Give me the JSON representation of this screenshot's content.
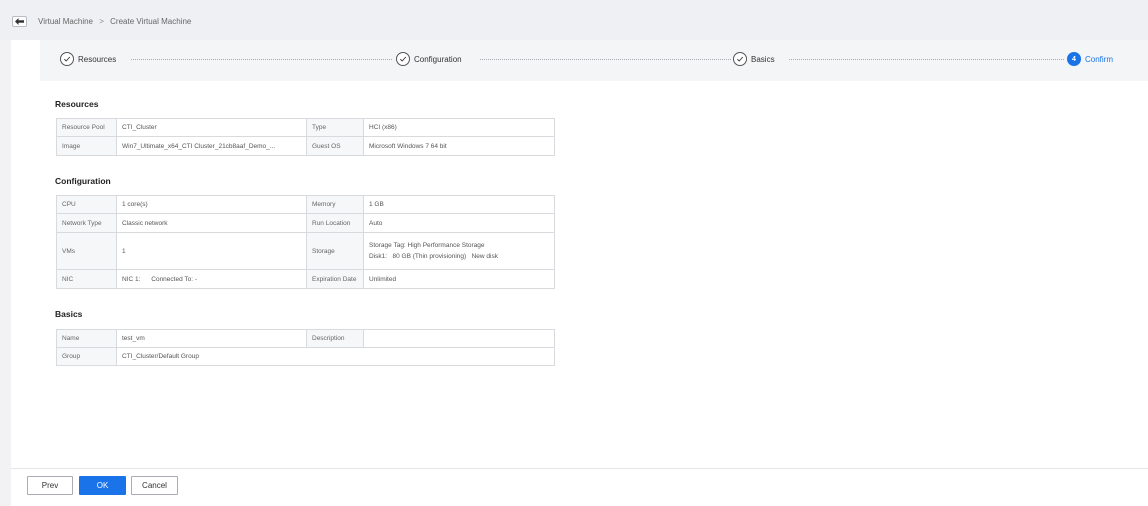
{
  "breadcrumb": {
    "parent": "Virtual Machine",
    "separator": ">",
    "current": "Create Virtual Machine"
  },
  "steps": [
    {
      "label": "Resources",
      "state": "done"
    },
    {
      "label": "Configuration",
      "state": "done"
    },
    {
      "label": "Basics",
      "state": "done"
    },
    {
      "label": "Confirm",
      "state": "active",
      "number": "4"
    }
  ],
  "resources": {
    "title": "Resources",
    "rows": [
      {
        "k1": "Resource Pool",
        "v1": "CTI_Cluster",
        "k2": "Type",
        "v2": "HCI (x86)"
      },
      {
        "k1": "Image",
        "v1": "Win7_Ultimate_x64_CTI Cluster_21cb8aaf_Demo_...",
        "k2": "Guest OS",
        "v2": "Microsoft Windows 7 64 bit"
      }
    ]
  },
  "configuration": {
    "title": "Configuration",
    "cpu_label": "CPU",
    "cpu_value": "1 core(s)",
    "memory_label": "Memory",
    "memory_value": "1 GB",
    "network_type_label": "Network Type",
    "network_type_value": "Classic network",
    "run_location_label": "Run Location",
    "run_location_value": "Auto",
    "vms_label": "VMs",
    "vms_value": "1",
    "storage_label": "Storage",
    "storage_tag": "Storage Tag: High Performance Storage",
    "storage_disk": "Disk1:   80 GB (Thin provisioning)   New disk",
    "nic_label": "NIC",
    "nic_value": "NIC 1:      Connected To: -",
    "expiration_label": "Expiration Date",
    "expiration_value": "Unlimited"
  },
  "basics": {
    "title": "Basics",
    "name_label": "Name",
    "name_value": "test_vm",
    "description_label": "Description",
    "description_value": "",
    "group_label": "Group",
    "group_value": "CTI_Cluster/Default Group"
  },
  "footer": {
    "prev": "Prev",
    "ok": "OK",
    "cancel": "Cancel"
  },
  "colors": {
    "primary": "#1a73e8",
    "background": "#f2f2f4"
  },
  "icons": {
    "back": "arrow-left-icon",
    "step_done": "check-circle-icon"
  }
}
